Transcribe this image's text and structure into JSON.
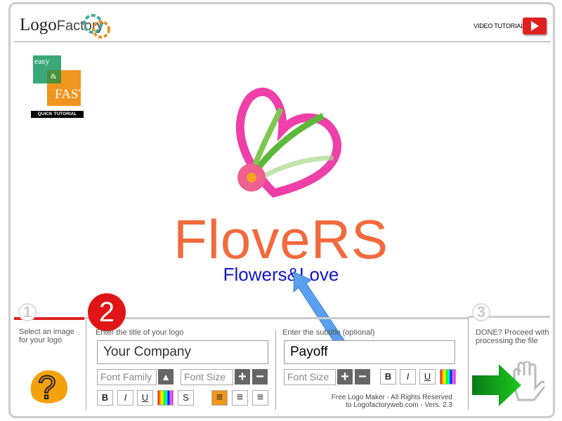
{
  "header": {
    "brand_logo": "LogoFactory",
    "brand_a": "Logo",
    "brand_b": "Factory",
    "video_tutorial": "VIDEO TUTORIAL",
    "play_icon": "play-icon"
  },
  "tutorial": {
    "easy": "easy",
    "amp": "&",
    "fast": "FAST",
    "label": "QUICK TUTORIAL"
  },
  "preview": {
    "title": "FloveRS",
    "subtitle": "Flowers&Love",
    "colors": {
      "title": "#f26a3c",
      "subtitle": "#1414c8"
    }
  },
  "step1": {
    "number": "1",
    "label": "Select an image for your logo",
    "icon": "question-mark-icon"
  },
  "step2": {
    "number": "2",
    "title_label": "Enter the title of your logo",
    "title_value": "Your Company",
    "font_family": "Font Family",
    "font_size": "Font Size",
    "bold": "B",
    "italic": "I",
    "underline": "U",
    "strike": "S",
    "align_selected": "left"
  },
  "subtitle_section": {
    "label": "Enter the subtitle (optional)",
    "value": "Payoff",
    "font_size": "Font Size",
    "bold": "B",
    "italic": "I",
    "underline": "U",
    "copyright_1": "Free Logo Maker - All Rights Reserved",
    "copyright_2": "to Logofactoryweb.com - Vers. 2.3"
  },
  "step3": {
    "number": "3",
    "label": "DONE? Proceed with processing the file"
  }
}
